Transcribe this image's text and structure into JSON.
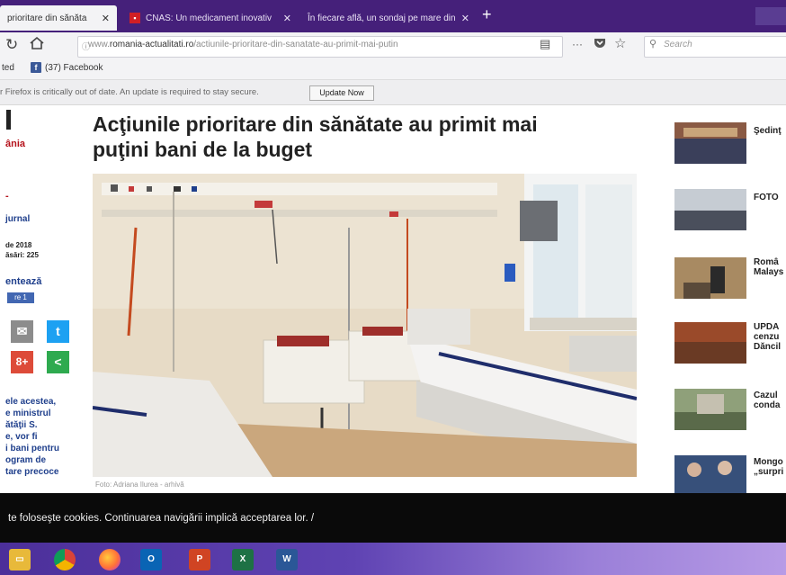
{
  "browser": {
    "tabs": [
      {
        "title": "prioritare din sănăta",
        "close": "✕",
        "active": true
      },
      {
        "title": "CNAS: Un medicament inovativ",
        "close": "✕",
        "active": false
      },
      {
        "title": "În fiecare află, un sondaj pe mare din",
        "close": "✕",
        "active": false
      }
    ],
    "new_tab": "+",
    "url_prefix": "www.",
    "url_domain": "romania-actualitati.ro",
    "url_path": "/actiunile-prioritare-din-sanatate-au-primit-mai-putin",
    "more_dots": "···",
    "search_placeholder": "Search",
    "bookmark_prefix": "ted",
    "bookmark_facebook": "(37) Facebook",
    "notice_text": "r Firefox is critically out of date. An update is required to stay secure.",
    "update_button": "Update Now"
  },
  "article": {
    "title_line1": "Acţiunile prioritare din sănătate au primit mai",
    "title_line2": "puţini bani de la buget",
    "photo_caption": "Foto: Adriana Ilurea - arhivă"
  },
  "left_sidebar": {
    "top_bar": "l",
    "brand": "ânia",
    "dash": "-",
    "jurnal": "jurnal",
    "date": "de 2018",
    "views": "ăsări: 225",
    "recommend": "entează",
    "like": "re 1",
    "body_lines": [
      "ele acestea,",
      "e ministrul",
      "ătăţii S.",
      "e, vor fi",
      "i bani pentru",
      "ogram de",
      "tare precoce"
    ]
  },
  "right_sidebar": {
    "items": [
      {
        "text": [
          "Şedinţ"
        ]
      },
      {
        "text": [
          "FOTO"
        ]
      },
      {
        "text": [
          "Româ",
          "Malays"
        ]
      },
      {
        "text": [
          "UPDA",
          "cenzu",
          "Dăncil"
        ]
      },
      {
        "text": [
          "Cazul",
          "conda"
        ]
      },
      {
        "text": [
          "Mongo",
          "„surpri"
        ]
      }
    ]
  },
  "cookie_text": "te foloseşte cookies. Continuarea navigării implică acceptarea lor. /",
  "taskbar": {
    "apps": [
      "file-explorer",
      "chrome",
      "firefox",
      "outlook",
      "powerpoint",
      "excel",
      "word"
    ]
  },
  "colors": {
    "tab_bar": "#45207a",
    "cookie_bar": "#0a0a0a",
    "brand_red": "#b5121b"
  }
}
